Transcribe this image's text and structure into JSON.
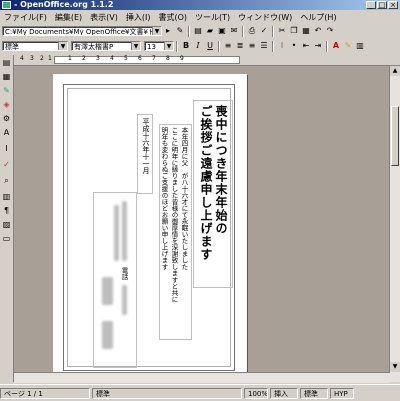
{
  "window": {
    "title": "- OpenOffice.org 1.1.2"
  },
  "menu": [
    "ファイル(F)",
    "編集(E)",
    "表示(V)",
    "挿入(I)",
    "書式(O)",
    "ツール(T)",
    "ウィンドウ(W)",
    "ヘルプ(H)"
  ],
  "toolbar": {
    "path": "C:¥My Documents¥My OpenOffice¥文書¥ドキュメント¥Wi",
    "style": "標準",
    "font": "有澤太楷書P",
    "size": "13"
  },
  "ruler": {
    "ticks": [
      "4",
      "3",
      "2",
      "1",
      "1",
      "2",
      "3",
      "4",
      "5",
      "6",
      "7",
      "8",
      "9"
    ]
  },
  "document": {
    "heading": [
      "喪中につき年末年始の",
      "ご挨拶ご遠慮申し上げます"
    ],
    "body": [
      "本年四月に父　が八十六才にて永眠いたしました",
      "ここに明年に縁りました皆様の御厚情を深謝致しますと共に",
      "明年も変わらぬご支援のほどお願い申し上げます"
    ],
    "date": "平成十六年十一月",
    "tel": "電話"
  },
  "status": {
    "page": "ページ 1 / 1",
    "style": "標準",
    "zoom": "100%",
    "insert": "挿入",
    "std": "標準",
    "hyp": "HYP"
  }
}
